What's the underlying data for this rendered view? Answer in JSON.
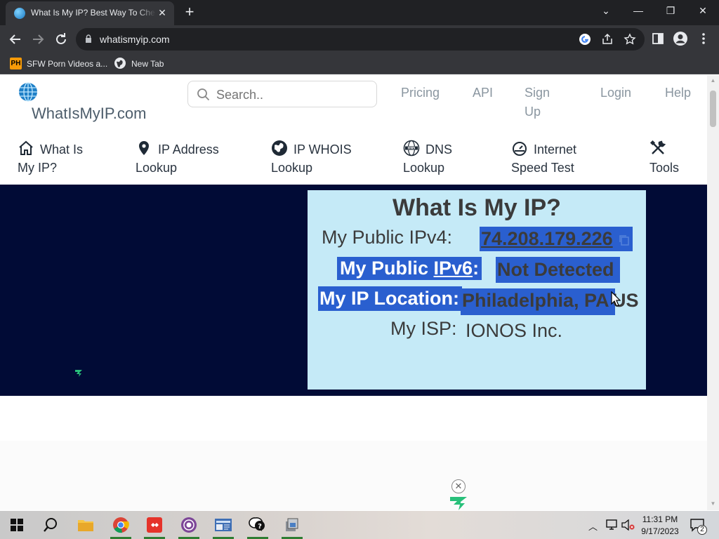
{
  "browser": {
    "tab_title": "What Is My IP? Best Way To Check Your Public IP Address",
    "tab_close": "✕",
    "new_tab": "+",
    "window_controls": [
      "⌄",
      "—",
      "❐",
      "✕"
    ],
    "url": "whatismyip.com",
    "bookmarks": [
      {
        "label": "SFW Porn Videos a...",
        "icon": "PH"
      },
      {
        "label": "New Tab",
        "icon": "globe-icon"
      }
    ]
  },
  "site": {
    "logo_text": "WhatIsMyIP.com",
    "search_placeholder": "Search..",
    "topnav": [
      "Pricing",
      "API",
      "Sign Up",
      "Login",
      "Help"
    ],
    "mainnav": [
      {
        "label": "What Is My IP?",
        "icon": "home-icon"
      },
      {
        "label": "IP Address Lookup",
        "icon": "map-pin-icon"
      },
      {
        "label": "IP WHOIS Lookup",
        "icon": "globe-icon"
      },
      {
        "label": "DNS Lookup",
        "icon": "dns-globe-icon"
      },
      {
        "label": "Internet Speed Test",
        "icon": "speedometer-icon"
      },
      {
        "label": "Tools",
        "icon": "tools-icon"
      }
    ]
  },
  "ip_card": {
    "title": "What Is My IP?",
    "ipv4_label": "My Public IPv4:",
    "ipv4_value": "74.208.179.226",
    "ipv6_label_prefix": "My Public ",
    "ipv6_label_link": "IPv6",
    "ipv6_label_suffix": ":",
    "ipv6_value": "Not Detected",
    "location_label": "My IP Location:",
    "location_value": "Philadelphia, PA",
    "location_country": "US",
    "isp_label": "My ISP:",
    "isp_value": "IONOS Inc."
  },
  "ad": {
    "close": "✕"
  },
  "taskbar": {
    "apps": [
      "windows-start",
      "search",
      "file-explorer",
      "chrome",
      "anydesk",
      "tor-browser",
      "id-card-app",
      "help-chat",
      "setup-app"
    ],
    "time": "11:31 PM",
    "date": "9/17/2023",
    "notifications": "2"
  },
  "colors": {
    "hero_bg": "#010b36",
    "card_bg": "#c5eaf7",
    "selection": "#2a5fcf"
  }
}
